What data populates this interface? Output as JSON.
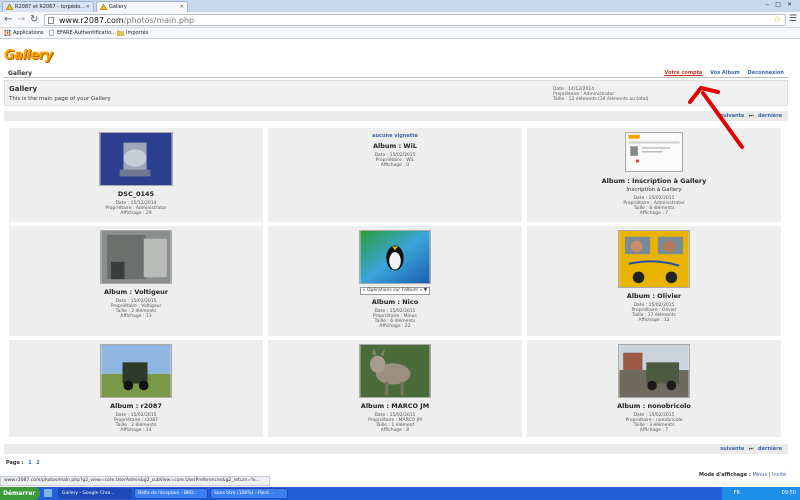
{
  "browser": {
    "tabs": [
      {
        "label": "R2087 et R2067 - torpédo..."
      },
      {
        "label": "Gallery"
      }
    ],
    "url_host": "www.r2087.com",
    "url_path": "/photos/main.php",
    "bookmarks": [
      {
        "label": "Applications"
      },
      {
        "label": "EFARE-Authentificatio..."
      },
      {
        "label": "Importés"
      }
    ],
    "status_url": "www.r2087.com/photos/main.php?g2_view=core.UserAdmin&g2_subView=core.UserPreferences&g2_return=%..."
  },
  "header": {
    "logo": "Gallery",
    "site_name": "Gallery",
    "links": [
      "Votre compte",
      "Vos Album",
      "Déconnexion"
    ]
  },
  "info": {
    "title": "Gallery",
    "description": "This is the main page of your Gallery",
    "meta": [
      "Date : 14/12/2014",
      "Propriétaire : Administrator",
      "Taille : 12 éléments (34 éléments au total)"
    ]
  },
  "pager": {
    "next": "suivante",
    "last": "dernière",
    "page_label": "Page :",
    "pages": [
      "1",
      "2"
    ]
  },
  "items": [
    {
      "title": "DSC_0145",
      "subtitle": "",
      "meta": [
        "Date : 15/12/2014",
        "Propriétaire : Administrator",
        "Affichage : 29"
      ]
    },
    {
      "no_thumb": "aucune vignette",
      "title": "Album : WiL",
      "subtitle": "",
      "meta": [
        "Date : 15/02/2015",
        "Propriétaire : WiL",
        "Affichage : 0"
      ]
    },
    {
      "title": "Album : Inscription à Gallery",
      "subtitle": "Inscription à Gallery",
      "meta": [
        "Date : 15/02/2015",
        "Propriétaire : Administrator",
        "Taille : 8 éléments",
        "Affichage : 7"
      ]
    },
    {
      "title": "Album : Voltigeur",
      "subtitle": "",
      "meta": [
        "Date : 15/02/2015",
        "Propriétaire : Voltigeur",
        "Taille : 2 éléments",
        "Affichage : 13"
      ]
    },
    {
      "select": "« Opérations sur l'album » ▼",
      "title": "Album : Nico",
      "subtitle": "",
      "meta": [
        "Date : 15/02/2015",
        "Propriétaire : Minus",
        "Taille : 6 éléments",
        "Affichage : 22"
      ]
    },
    {
      "title": "Album : Olivier",
      "subtitle": "",
      "meta": [
        "Date : 15/02/2015",
        "Propriétaire : Olivier",
        "Taille : 17 éléments",
        "Affichage : 12"
      ]
    },
    {
      "title": "Album : r2087",
      "subtitle": "",
      "meta": [
        "Date : 15/02/2015",
        "Propriétaire : r2087",
        "Taille : 2 éléments",
        "Affichage : 14"
      ]
    },
    {
      "title": "Album : MARCO JM",
      "subtitle": "",
      "meta": [
        "Date : 15/02/2015",
        "Propriétaire : MARCO JM",
        "Taille : 1 élément",
        "Affichage : 8"
      ]
    },
    {
      "title": "Album : nonobricolo",
      "subtitle": "",
      "meta": [
        "Date : 15/02/2015",
        "Propriétaire : nonobricolo",
        "Taille : 3 éléments",
        "Affichage : 7"
      ]
    }
  ],
  "footer": {
    "mode_label": "Mode d'affichage :",
    "modes": [
      "Minus",
      "Invité"
    ]
  },
  "taskbar": {
    "start": "Démarrer",
    "tasks": [
      "Gallery - Google Chro...",
      "Boîte de réception - BRO...",
      "Sans titre (100%) - Paint..."
    ],
    "lang": "FR",
    "time": "09:50"
  },
  "colors": {
    "link": "#3b66a8",
    "active_link": "#c0392b",
    "arrow": "#e00000",
    "logo": "#f5a300"
  }
}
